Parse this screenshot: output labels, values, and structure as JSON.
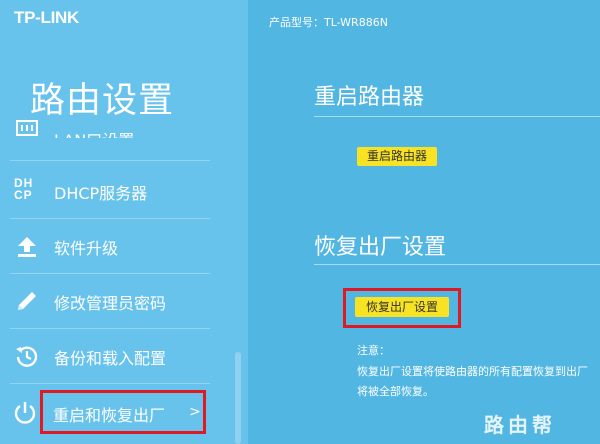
{
  "brand": "TP-LINK",
  "model_label": "产品型号：TL-WR886N",
  "sidebar": {
    "section_title": "路由设置",
    "items": [
      {
        "label": "LAN口设置",
        "icon": "lan-icon"
      },
      {
        "label": "DHCP服务器",
        "icon": "dhcp-icon",
        "icon_text_top": "DH",
        "icon_text_bottom": "CP"
      },
      {
        "label": "软件升级",
        "icon": "upload-icon"
      },
      {
        "label": "修改管理员密码",
        "icon": "pencil-icon"
      },
      {
        "label": "备份和载入配置",
        "icon": "history-icon"
      }
    ],
    "active_item": {
      "label": "重启和恢复出厂",
      "chevron": ">",
      "icon": "power-icon"
    }
  },
  "main": {
    "reboot": {
      "heading": "重启路由器",
      "button": "重启路由器"
    },
    "restore": {
      "heading": "恢复出厂设置",
      "button": "恢复出厂设置"
    },
    "note": {
      "title": "注意：",
      "line1": "恢复出厂设置将使路由器的所有配置恢复到出厂",
      "line2": "将被全部恢复。"
    }
  },
  "watermark": "路由帮",
  "colors": {
    "main_bg": "#52b6e2",
    "sidebar_bg": "#68c3ec",
    "button_yellow": "#f7e323",
    "highlight_red": "#e01a22"
  }
}
